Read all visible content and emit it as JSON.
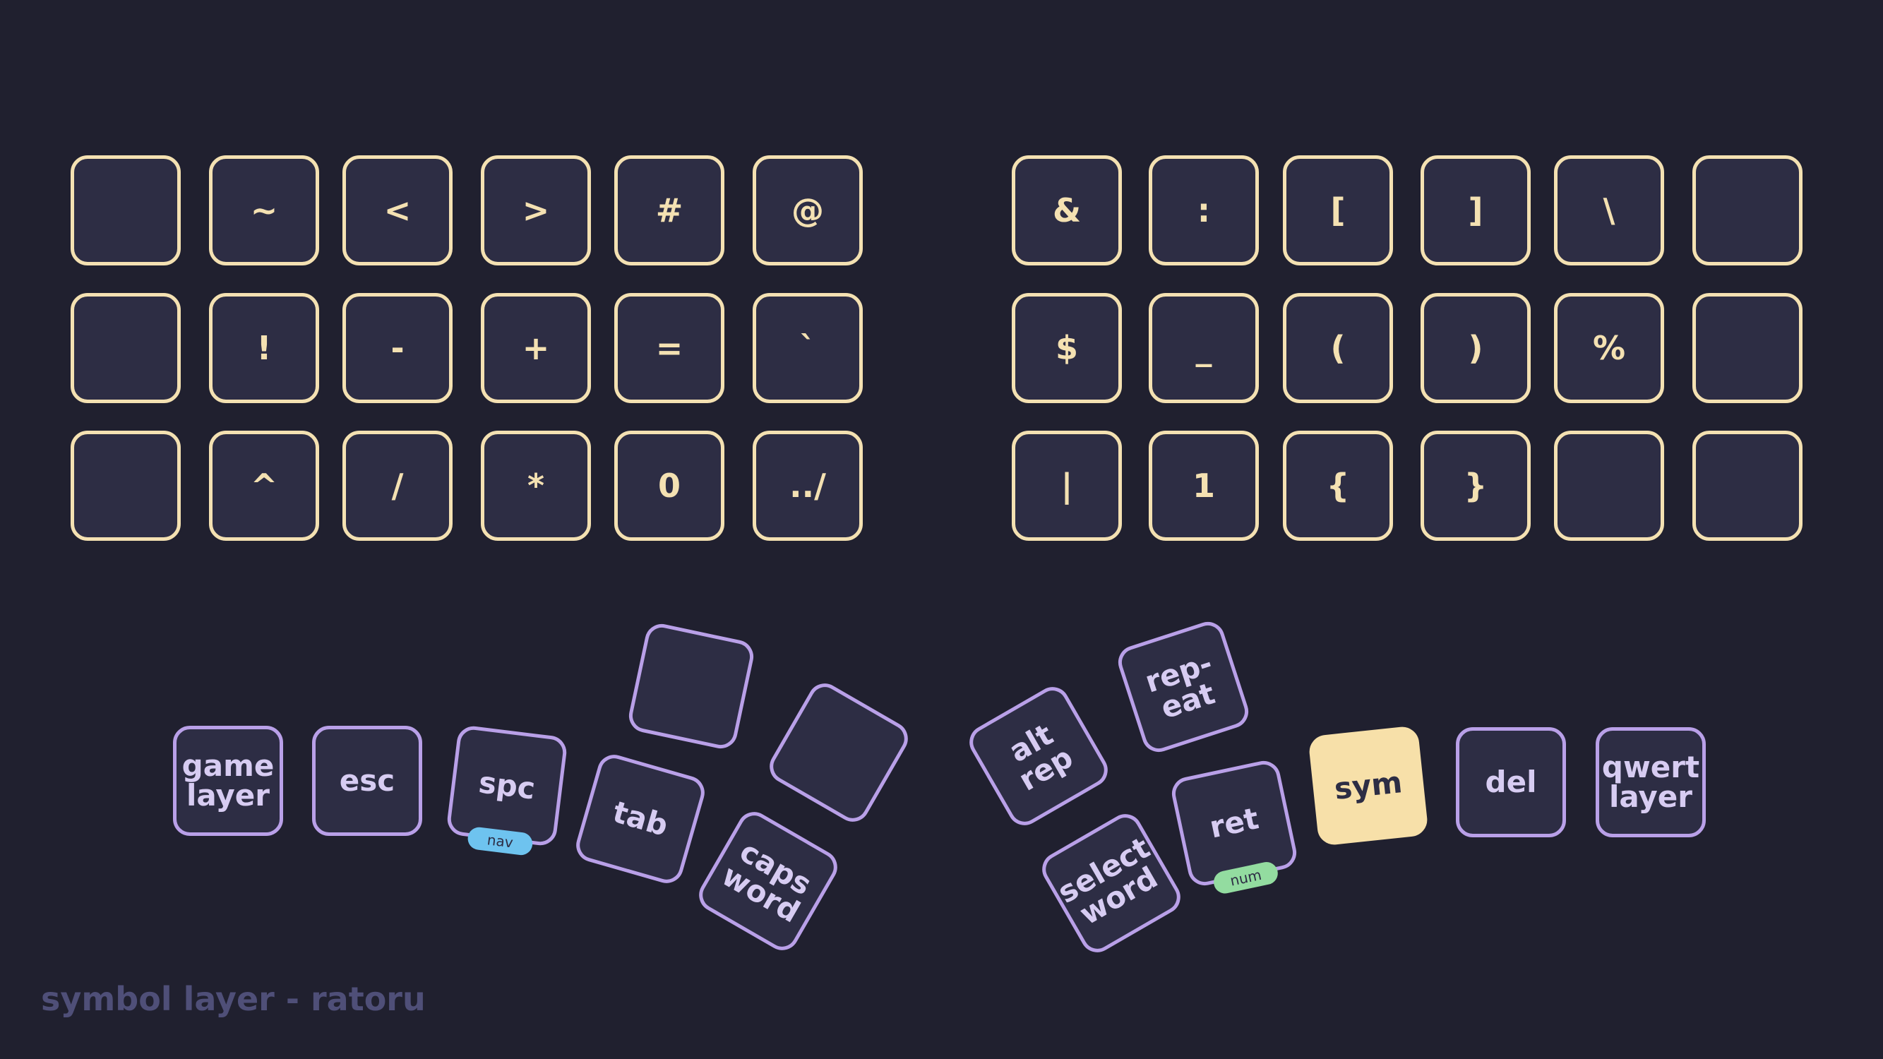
{
  "left_grid": [
    [
      "",
      "~",
      "<",
      ">",
      "#",
      "@"
    ],
    [
      "",
      "!",
      "-",
      "+",
      "=",
      "`"
    ],
    [
      "",
      "^",
      "/",
      "*",
      "0",
      "../"
    ]
  ],
  "right_grid": [
    [
      "&",
      ":",
      "[",
      "]",
      "\\",
      ""
    ],
    [
      "$",
      "_",
      "(",
      ")",
      "%",
      ""
    ],
    [
      "|",
      "1",
      "{",
      "}",
      "",
      ""
    ]
  ],
  "thumb_keys": [
    {
      "label": "game\nlayer",
      "badge": "",
      "active": false
    },
    {
      "label": "esc",
      "badge": "",
      "active": false
    },
    {
      "label": "spc",
      "badge": "nav",
      "active": false
    },
    {
      "label": "",
      "badge": "",
      "active": false
    },
    {
      "label": "tab",
      "badge": "",
      "active": false
    },
    {
      "label": "",
      "badge": "",
      "active": false
    },
    {
      "label": "caps\nword",
      "badge": "",
      "active": false
    },
    {
      "label": "alt\nrep",
      "badge": "",
      "active": false
    },
    {
      "label": "rep-\neat",
      "badge": "",
      "active": false
    },
    {
      "label": "select\nword",
      "badge": "",
      "active": false
    },
    {
      "label": "ret",
      "badge": "num",
      "active": false
    },
    {
      "label": "sym",
      "badge": "",
      "active": true
    },
    {
      "label": "del",
      "badge": "",
      "active": false
    },
    {
      "label": "qwert\nlayer",
      "badge": "",
      "active": false
    }
  ],
  "caption": "symbol layer - ratoru",
  "colors": {
    "background": "#20202f",
    "key_fill": "#2d2d44",
    "main_border": "#f4e1b2",
    "thumb_border": "#b9a0e8",
    "active_key": "#f7e0a9",
    "nav_badge": "#6ec3ef",
    "num_badge": "#93dca0",
    "caption": "#4f4f78"
  }
}
